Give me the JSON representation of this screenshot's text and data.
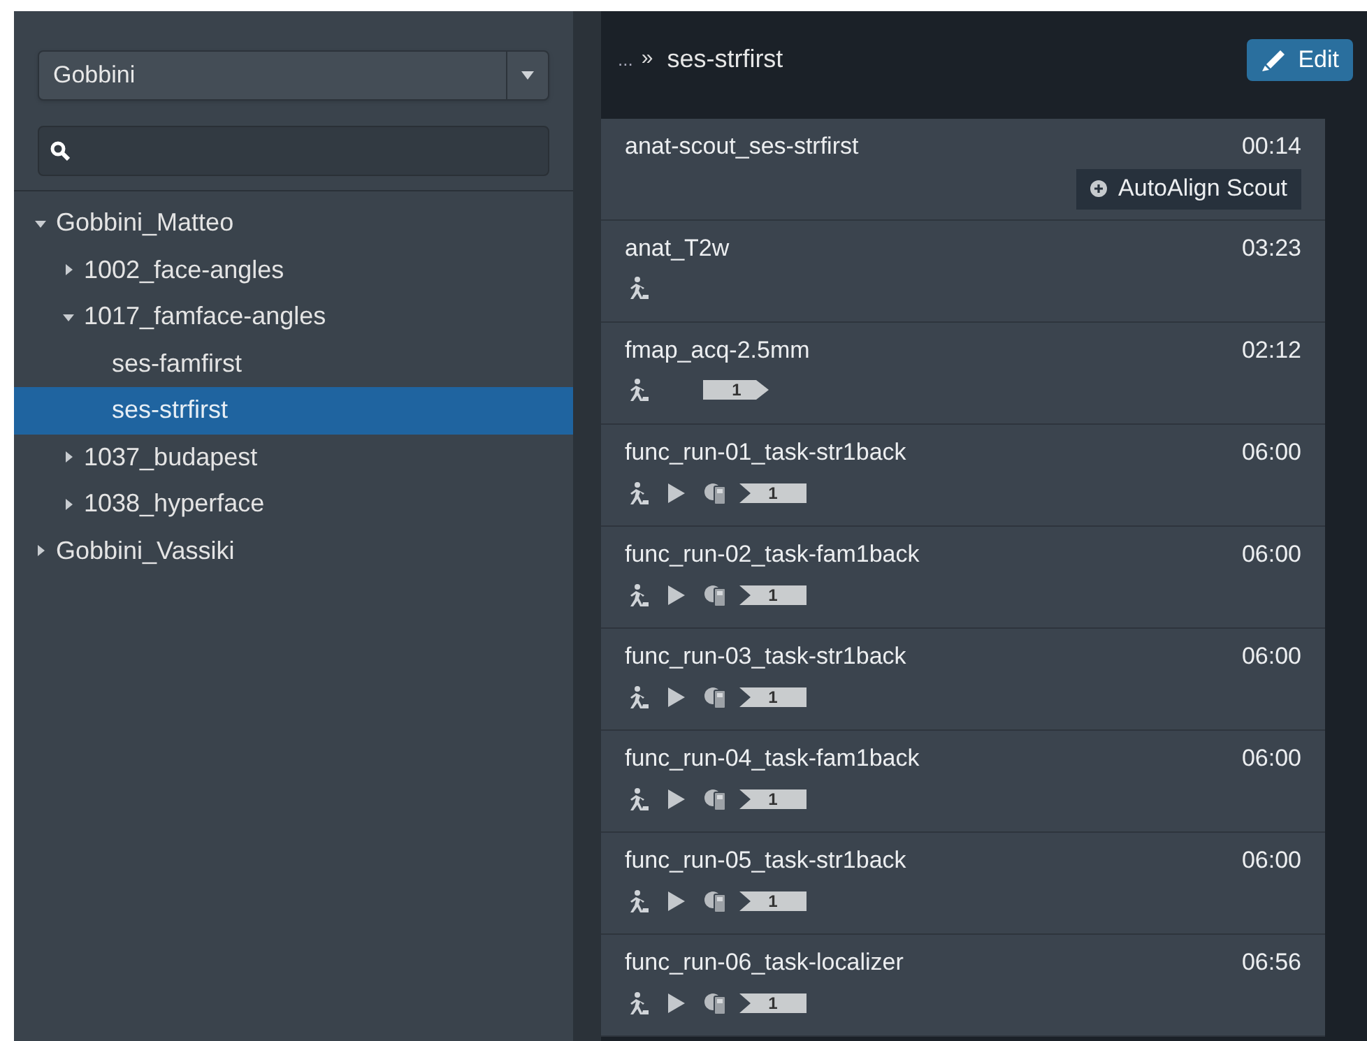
{
  "sidebar": {
    "project_select": {
      "value": "Gobbini"
    },
    "tree": [
      {
        "label": "Gobbini_Matteo",
        "expanded": true,
        "selected": false,
        "children": [
          {
            "label": "1002_face-angles",
            "expanded": false,
            "selected": false
          },
          {
            "label": "1017_famface-angles",
            "expanded": true,
            "selected": false,
            "children": [
              {
                "label": "ses-famfirst",
                "selected": false
              },
              {
                "label": "ses-strfirst",
                "selected": true
              }
            ]
          },
          {
            "label": "1037_budapest",
            "expanded": false,
            "selected": false
          },
          {
            "label": "1038_hyperface",
            "expanded": false,
            "selected": false
          }
        ]
      },
      {
        "label": "Gobbini_Vassiki",
        "expanded": false,
        "selected": false
      }
    ]
  },
  "header": {
    "breadcrumb_ellipsis": "...",
    "breadcrumb_separator": "»",
    "breadcrumb_current": "ses-strfirst",
    "edit_button": "Edit"
  },
  "scans": [
    {
      "name": "anat-scout_ses-strfirst",
      "duration": "00:14",
      "action": "AutoAlign Scout"
    },
    {
      "name": "anat_T2w",
      "duration": "03:23",
      "icons": [
        {
          "kind": "patient"
        }
      ]
    },
    {
      "name": "fmap_acq-2.5mm",
      "duration": "02:12",
      "icons": [
        {
          "kind": "patient"
        },
        {
          "kind": "gap"
        },
        {
          "kind": "tag",
          "text": "1"
        }
      ]
    },
    {
      "name": "func_run-01_task-str1back",
      "duration": "06:00",
      "icons": [
        {
          "kind": "patient"
        },
        {
          "kind": "play"
        },
        {
          "kind": "device"
        },
        {
          "kind": "chevron",
          "text": "1"
        }
      ]
    },
    {
      "name": "func_run-02_task-fam1back",
      "duration": "06:00",
      "icons": [
        {
          "kind": "patient"
        },
        {
          "kind": "play"
        },
        {
          "kind": "device"
        },
        {
          "kind": "chevron",
          "text": "1"
        }
      ]
    },
    {
      "name": "func_run-03_task-str1back",
      "duration": "06:00",
      "icons": [
        {
          "kind": "patient"
        },
        {
          "kind": "play"
        },
        {
          "kind": "device"
        },
        {
          "kind": "chevron",
          "text": "1"
        }
      ]
    },
    {
      "name": "func_run-04_task-fam1back",
      "duration": "06:00",
      "icons": [
        {
          "kind": "patient"
        },
        {
          "kind": "play"
        },
        {
          "kind": "device"
        },
        {
          "kind": "chevron",
          "text": "1"
        }
      ]
    },
    {
      "name": "func_run-05_task-str1back",
      "duration": "06:00",
      "icons": [
        {
          "kind": "patient"
        },
        {
          "kind": "play"
        },
        {
          "kind": "device"
        },
        {
          "kind": "chevron",
          "text": "1"
        }
      ]
    },
    {
      "name": "func_run-06_task-localizer",
      "duration": "06:56",
      "icons": [
        {
          "kind": "patient"
        },
        {
          "kind": "play"
        },
        {
          "kind": "device"
        },
        {
          "kind": "chevron",
          "text": "1"
        }
      ]
    }
  ]
}
